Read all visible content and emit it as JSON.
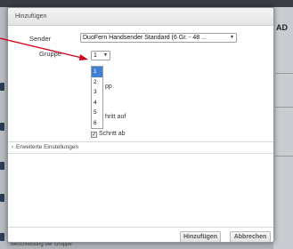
{
  "dialog": {
    "title": "Hinzufügen",
    "sender_label": "Sender",
    "sender_value": "DuoFern Handsender Standard (6 Gr. - 48 ...",
    "gruppe_label": "Gruppe",
    "gruppe_value": "1",
    "gruppe_options": [
      "1",
      "2",
      "3",
      "4",
      "5",
      "6"
    ],
    "partial_pp": "pp",
    "partial_schritt_auf": "hritt auf",
    "schritt_ab_label": "Schritt ab",
    "advanced_label": "Erweiterte Einstellungen",
    "add_button": "Hinzufügen",
    "cancel_button": "Abbrechen"
  },
  "background": {
    "right_label": "AD",
    "bottom_label": "Beschreibung der Gruppe"
  },
  "colors": {
    "selected_option": "#3f7fd6",
    "annotation_arrow": "#d0021b"
  }
}
